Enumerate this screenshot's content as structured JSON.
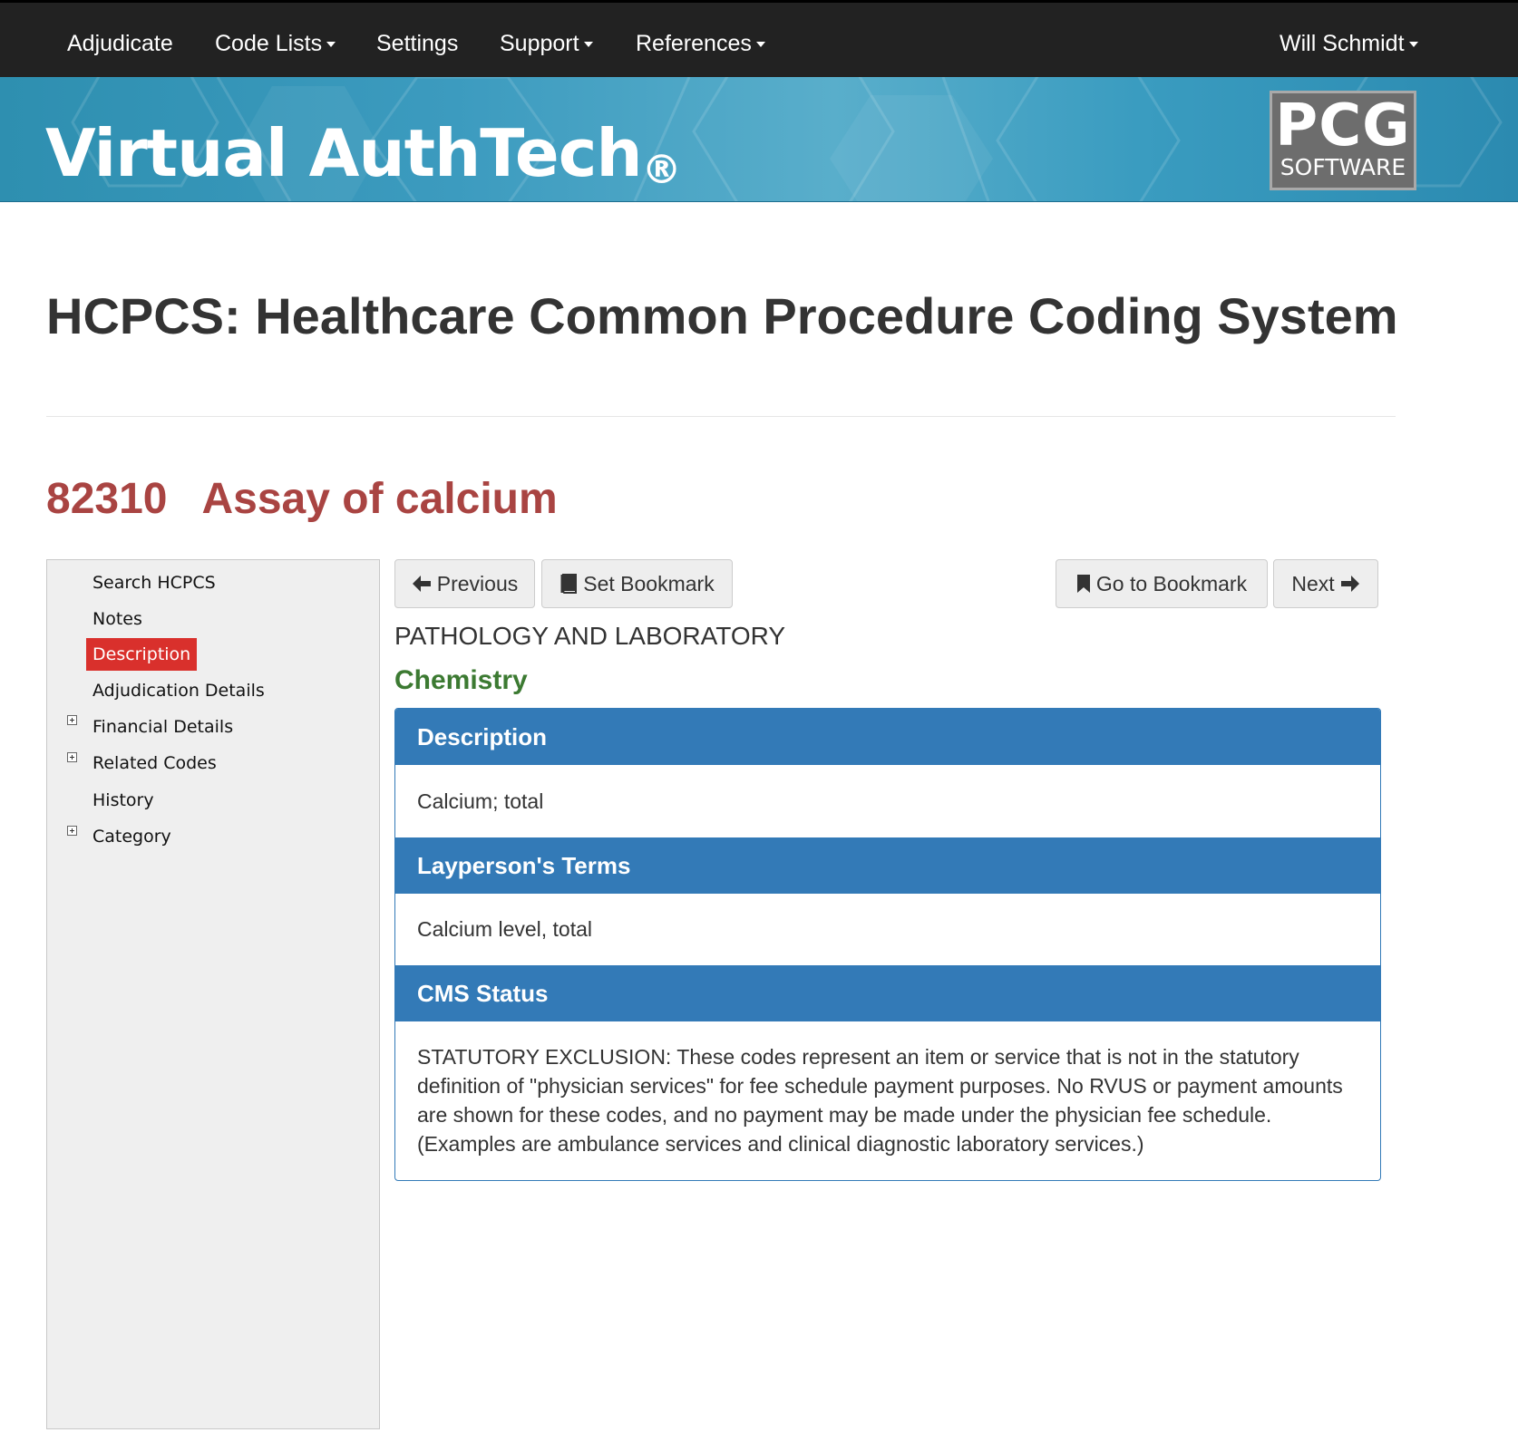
{
  "topnav": {
    "items": [
      {
        "label": "Adjudicate",
        "dropdown": false
      },
      {
        "label": "Code Lists",
        "dropdown": true
      },
      {
        "label": "Settings",
        "dropdown": false
      },
      {
        "label": "Support",
        "dropdown": true
      },
      {
        "label": "References",
        "dropdown": true
      }
    ],
    "user": "Will Schmidt"
  },
  "banner": {
    "brand": "Virtual AuthTech",
    "registered_mark": "®",
    "logo_top": "PCG",
    "logo_bottom": "SOFTWARE"
  },
  "page": {
    "title": "HCPCS: Healthcare Common Procedure Coding System",
    "code": "82310",
    "code_name": "Assay of calcium"
  },
  "sidebar": {
    "items": [
      {
        "label": "Search HCPCS",
        "expandable": false,
        "active": false
      },
      {
        "label": "Notes",
        "expandable": false,
        "active": false
      },
      {
        "label": "Description",
        "expandable": false,
        "active": true
      },
      {
        "label": "Adjudication Details",
        "expandable": false,
        "active": false
      },
      {
        "label": "Financial Details",
        "expandable": true,
        "active": false
      },
      {
        "label": "Related Codes",
        "expandable": true,
        "active": false
      },
      {
        "label": "History",
        "expandable": false,
        "active": false
      },
      {
        "label": "Category",
        "expandable": true,
        "active": false
      }
    ]
  },
  "toolbar": {
    "previous": "Previous",
    "set_bookmark": "Set Bookmark",
    "go_to_bookmark": "Go to Bookmark",
    "next": "Next"
  },
  "content": {
    "section": "PATHOLOGY AND LABORATORY",
    "subsection": "Chemistry",
    "panels": [
      {
        "heading": "Description",
        "body": "Calcium; total"
      },
      {
        "heading": "Layperson's Terms",
        "body": "Calcium level, total"
      },
      {
        "heading": "CMS Status",
        "body": "STATUTORY EXCLUSION: These codes represent an item or service that is not in the statutory definition of \"physician services\" for fee schedule payment purposes. No RVUS or payment amounts are shown for these codes, and no payment may be made under the physician fee schedule. (Examples are ambulance services and clinical diagnostic laboratory services.)"
      }
    ]
  },
  "colors": {
    "navbar": "#222222",
    "banner": "#3c9bbf",
    "panel_header": "#337ab7",
    "code_heading": "#a94442",
    "subsection": "#3c7a32",
    "active_sidebar": "#d9302c"
  }
}
